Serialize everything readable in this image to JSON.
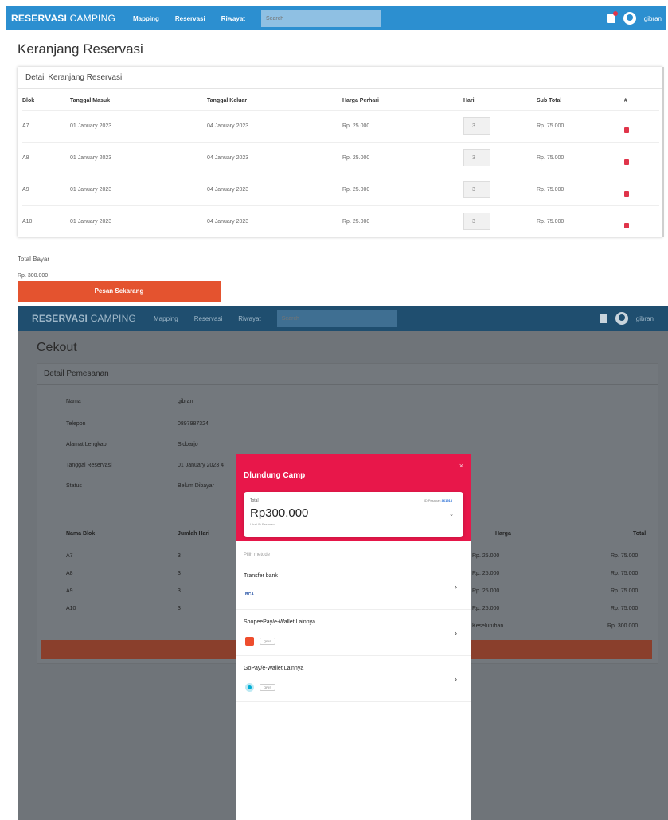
{
  "cart": {
    "nav": {
      "brand_a": "RESERVASI",
      "brand_b": " CAMPING",
      "links": [
        "Mapping",
        "Reservasi",
        "Riwayat"
      ],
      "search_placeholder": "Search",
      "user": "gibran"
    },
    "title": "Keranjang Reservasi",
    "card_title": "Detail Keranjang Reservasi",
    "columns": [
      "Blok",
      "Tanggal Masuk",
      "Tanggal Keluar",
      "Harga Perhari",
      "Hari",
      "Sub Total",
      "#"
    ],
    "rows": [
      {
        "blok": "A7",
        "masuk": "01 January 2023",
        "keluar": "04 January 2023",
        "harga": "Rp. 25.000",
        "hari": "3",
        "subtotal": "Rp. 75.000"
      },
      {
        "blok": "A8",
        "masuk": "01 January 2023",
        "keluar": "04 January 2023",
        "harga": "Rp. 25.000",
        "hari": "3",
        "subtotal": "Rp. 75.000"
      },
      {
        "blok": "A9",
        "masuk": "01 January 2023",
        "keluar": "04 January 2023",
        "harga": "Rp. 25.000",
        "hari": "3",
        "subtotal": "Rp. 75.000"
      },
      {
        "blok": "A10",
        "masuk": "01 January 2023",
        "keluar": "04 January 2023",
        "harga": "Rp. 25.000",
        "hari": "3",
        "subtotal": "Rp. 75.000"
      }
    ],
    "total_label": "Total Bayar",
    "total_value": "Rp. 300.000",
    "order_button": "Pesan Sekarang"
  },
  "checkout": {
    "title": "Cekout",
    "card_title": "Detail Pemesanan",
    "details": [
      {
        "label": "Nama",
        "value": "gibran"
      },
      {
        "label": "Telepon",
        "value": "0897987324"
      },
      {
        "label": "Alamat Lengkap",
        "value": "Sidoarjo"
      },
      {
        "label": "Tanggal Reservasi",
        "value": "01 January 2023 4"
      },
      {
        "label": "Status",
        "value": "Belum Dibayar"
      }
    ],
    "columns": [
      "Nama Blok",
      "Jumlah Hari",
      "Harga",
      "Total"
    ],
    "rows": [
      {
        "blok": "A7",
        "hari": "3",
        "harga": "Rp. 25.000",
        "total": "Rp. 75.000"
      },
      {
        "blok": "A8",
        "hari": "3",
        "harga": "Rp. 25.000",
        "total": "Rp. 75.000"
      },
      {
        "blok": "A9",
        "hari": "3",
        "harga": "Rp. 25.000",
        "total": "Rp. 75.000"
      },
      {
        "blok": "A10",
        "hari": "3",
        "harga": "Rp. 25.000",
        "total": "Rp. 75.000"
      }
    ],
    "grand_label": "Keseluruhan",
    "grand_total": "Rp. 300.000"
  },
  "modal": {
    "title": "Dlundung Camp",
    "close": "×",
    "total_label": "Total",
    "amount": "Rp300.000",
    "sub_text": "Lihat ID Pesanan",
    "order_label": "ID Pesanan",
    "order_id": "861918",
    "pick_label": "Pilih metode",
    "methods": [
      {
        "name": "Transfer bank",
        "logo": "BCA"
      },
      {
        "name": "ShopeePay/e-Wallet Lainnya",
        "logo": "QRIS"
      },
      {
        "name": "GoPay/e-Wallet Lainnya",
        "logo": "QRIS"
      }
    ]
  },
  "colors": {
    "nav_blue": "#2c8fd0",
    "order_orange": "#e4532f",
    "modal_red": "#e8174a",
    "trash_red": "#e0344a"
  }
}
